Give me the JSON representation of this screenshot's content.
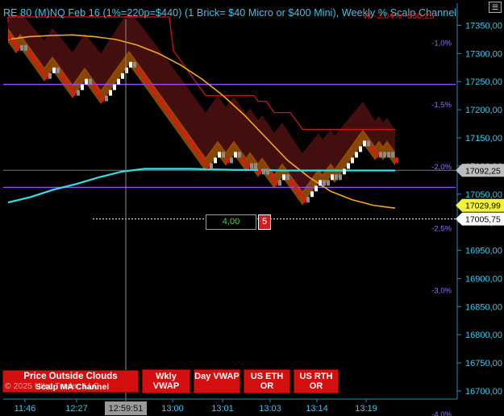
{
  "window": {
    "title": "RE 80 (M)NQ Feb 16 (1%=220p=$440) (1 Brick= $40 Micro or $400 Mini), Weekly %  Scalp Channel",
    "title_overlay_red": "W -3,04% -530,25",
    "menu_icon": "hamburger-icon"
  },
  "colors": {
    "background": "#000000",
    "bull_brick": "#ffffff",
    "bear_brick": "#e0141a",
    "neutral_brick": "#8c8c8c",
    "orange_cloud": "#b35c00",
    "dark_red_cloud": "#4a0f10",
    "orange_ma": "#f5a623",
    "vwap": "#2fe0e8",
    "upper_channel": "#e01010",
    "purple_line": "#9a4dff",
    "axis_text": "#3ec3e6",
    "percent_text": "#8f6fff"
  },
  "chart_data": {
    "type": "renko",
    "title": "",
    "y_axis": {
      "min": 16700,
      "max": 17375,
      "ticks": [
        17350,
        17300,
        17250,
        17200,
        17150,
        17100,
        17050,
        17000,
        16950,
        16900,
        16850,
        16800,
        16750,
        16700
      ],
      "tick_labels": [
        "17350,00",
        "17300,00",
        "17250,00",
        "17200,00",
        "17150,00",
        "17100,00",
        "17050,00",
        "17000,00",
        "16950,00",
        "16900,00",
        "16850,00",
        "16800,00",
        "16750,00",
        "16700,00"
      ]
    },
    "percent_labels": [
      {
        "label": "-1,0%",
        "price": 17320
      },
      {
        "label": "-1,5%",
        "price": 17210
      },
      {
        "label": "-2,0%",
        "price": 17100
      },
      {
        "label": "-2,5%",
        "price": 16990
      },
      {
        "label": "-3,0%",
        "price": 16880
      },
      {
        "label": "-4,0%",
        "price": 16660
      }
    ],
    "x_axis": {
      "tick_labels": [
        "11:46",
        "12:27",
        "12:59:51",
        "13:00",
        "13:01",
        "13:03",
        "13:14",
        "13:19"
      ],
      "tick_positions": [
        0,
        27,
        49,
        69,
        92,
        114,
        136,
        158
      ],
      "highlighted": "12:59:51"
    },
    "price_markers": [
      {
        "label": "17092,25",
        "price": 17092.25,
        "style": "gray"
      },
      {
        "label": "17029,99",
        "price": 17029.99,
        "style": "yellow"
      },
      {
        "label": "17005,75",
        "price": 17005.75,
        "style": "white"
      }
    ],
    "horizontal_lines": [
      {
        "name": "upper-purple",
        "price": 17245
      },
      {
        "name": "lower-purple",
        "price": 17062
      },
      {
        "name": "current-price-dotted",
        "price": 17005.75
      },
      {
        "name": "gray-level",
        "price": 17092.25
      }
    ],
    "bricks": {
      "brick_size": 10,
      "directions": [
        -1,
        -1,
        -1,
        1,
        -1,
        -1,
        -1,
        -1,
        -1,
        -1,
        1,
        1,
        -1,
        -1,
        -1,
        -1,
        -1,
        1,
        1,
        1,
        -1,
        -1,
        -1,
        -1,
        1,
        1,
        1,
        1,
        1,
        1,
        1,
        -1,
        -1,
        -1,
        -1,
        -1,
        -1,
        -1,
        -1,
        -1,
        -1,
        -1,
        -1,
        -1,
        -1,
        -1,
        -1,
        -1,
        -1,
        -1,
        1,
        1,
        1,
        -1,
        -1,
        1,
        1,
        -1,
        -1,
        -1,
        1,
        -1,
        -1,
        1,
        -1,
        -1,
        -1,
        1,
        1,
        -1,
        -1,
        -1,
        -1,
        -1,
        1,
        1,
        1,
        1,
        -1,
        1,
        1,
        -1,
        1,
        1,
        1,
        1,
        1,
        1,
        1,
        -1,
        -1,
        -1,
        1,
        -1,
        1,
        -1,
        -1
      ],
      "start_price": 17335
    },
    "series": [
      {
        "name": "",
        "kind": "orange-ma",
        "values": [
          17325,
          17330,
          17332,
          17333,
          17330,
          17325,
          17315,
          17300,
          17280,
          17255,
          17225,
          17190,
          17150,
          17110,
          17080,
          17055,
          17040,
          17030,
          17025
        ]
      },
      {
        "name": "",
        "kind": "vwap",
        "values": [
          17035,
          17045,
          17058,
          17068,
          17080,
          17090,
          17095,
          17095,
          17095,
          17094,
          17093,
          17093,
          17092,
          17092,
          17092,
          17092,
          17092,
          17092
        ]
      }
    ]
  },
  "controls": {
    "price_outside_clouds": "Price Outside Clouds",
    "scalp_ma_channel": "Scalp MA Channel",
    "copyright": "© 2025 Ultra Trader, LLC",
    "wkly_vwap": "Wkly VWAP",
    "day_vwap": "Day VWAP",
    "us_eth_or": "US ETH OR",
    "us_rth_or": "US RTH OR"
  },
  "overlay": {
    "value_box": "4,00",
    "count_box": "5"
  }
}
